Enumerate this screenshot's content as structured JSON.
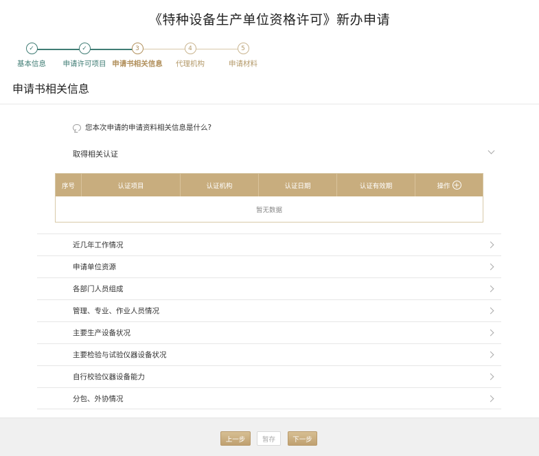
{
  "page": {
    "title": "《特种设备生产单位资格许可》新办申请",
    "section_title": "申请书相关信息"
  },
  "stepper": {
    "steps": [
      {
        "num": "",
        "label": "基本信息",
        "state": "done",
        "icon": "check-icon"
      },
      {
        "num": "",
        "label": "申请许可项目",
        "state": "done",
        "icon": "check-icon"
      },
      {
        "num": "3",
        "label": "申请书相关信息",
        "state": "active"
      },
      {
        "num": "4",
        "label": "代理机构",
        "state": "todo"
      },
      {
        "num": "5",
        "label": "申请材料",
        "state": "todo"
      }
    ]
  },
  "question": "您本次申请的申请资料相关信息是什么?",
  "cert": {
    "heading": "取得相关认证",
    "columns": [
      "序号",
      "认证项目",
      "认证机构",
      "认证日期",
      "认证有效期",
      "操作"
    ],
    "empty_text": "暂无数据"
  },
  "sections": [
    "近几年工作情况",
    "申请单位资源",
    "各部门人员组成",
    "管理、专业、作业人员情况",
    "主要生产设备状况",
    "主要检验与试验仪器设备状况",
    "自行校验仪器设备能力",
    "分包、外协情况"
  ],
  "footer": {
    "prev": "上一步",
    "save": "暂存",
    "next": "下一步"
  },
  "colors": {
    "accent": "#c8ad7e",
    "done": "#3f7c74"
  }
}
